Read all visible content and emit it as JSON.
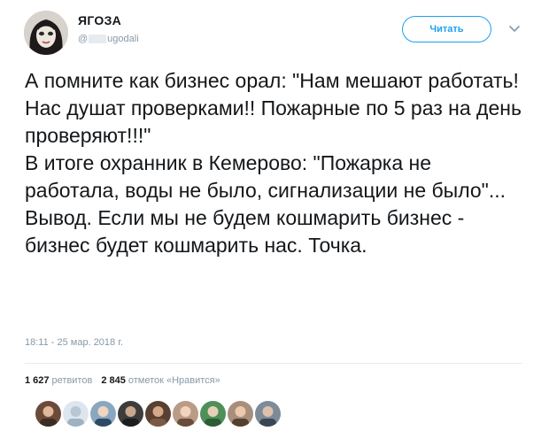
{
  "user": {
    "name": "ЯГОЗА",
    "handle_prefix": "@",
    "handle_suffix": "ugodali"
  },
  "follow_button": {
    "label": "Читать"
  },
  "tweet": {
    "text": "А помните как бизнес орал: \"Нам мешают работать! Нас душат проверками!! Пожарные по 5 раз на день проверяют!!!\"\nВ итоге охранник в Кемерово: \"Пожарка не работала, воды не было, сигнализации не было\"...\nВывод. Если мы не будем кошмарить бизнес - бизнес будет кошмарить нас. Точка.",
    "time": "18:11 - 25 мар. 2018 г."
  },
  "stats": {
    "retweets_count": "1 627",
    "retweets_label": "ретвитов",
    "likes_count": "2 845",
    "likes_label": "отметок «Нравится»"
  },
  "likers": [
    "liker-avatar",
    "liker-avatar",
    "liker-avatar",
    "liker-avatar",
    "liker-avatar",
    "liker-avatar",
    "liker-avatar",
    "liker-avatar",
    "liker-avatar"
  ],
  "colors": {
    "accent": "#1da1f2",
    "text": "#14171a",
    "muted": "#8899a6",
    "divider": "#e6ecf0"
  }
}
